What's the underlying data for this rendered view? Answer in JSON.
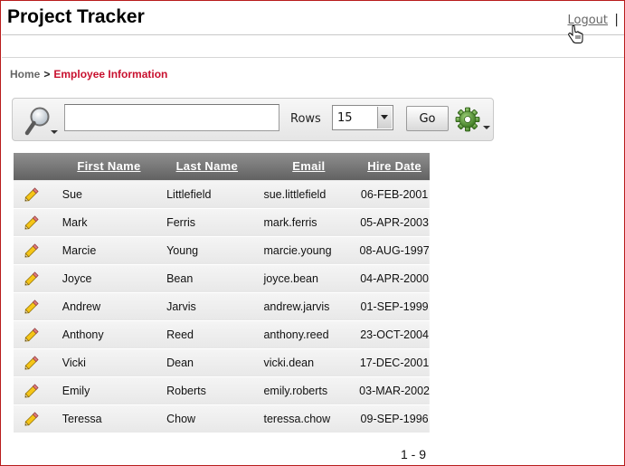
{
  "app": {
    "title": "Project Tracker",
    "logout_label": "Logout",
    "separator": "|"
  },
  "breadcrumb": {
    "home": "Home",
    "separator": ">",
    "current": "Employee Information"
  },
  "search": {
    "value": "",
    "rows_label": "Rows",
    "rows_value": "15",
    "go_label": "Go",
    "icons": [
      "search-icon",
      "gear-icon"
    ]
  },
  "report": {
    "columns": [
      "First Name",
      "Last Name",
      "Email",
      "Hire Date"
    ],
    "rows": [
      {
        "first": "Sue",
        "last": "Littlefield",
        "email": "sue.littlefield",
        "hire": "06-FEB-2001"
      },
      {
        "first": "Mark",
        "last": "Ferris",
        "email": "mark.ferris",
        "hire": "05-APR-2003"
      },
      {
        "first": "Marcie",
        "last": "Young",
        "email": "marcie.young",
        "hire": "08-AUG-1997"
      },
      {
        "first": "Joyce",
        "last": "Bean",
        "email": "joyce.bean",
        "hire": "04-APR-2000"
      },
      {
        "first": "Andrew",
        "last": "Jarvis",
        "email": "andrew.jarvis",
        "hire": "01-SEP-1999"
      },
      {
        "first": "Anthony",
        "last": "Reed",
        "email": "anthony.reed",
        "hire": "23-OCT-2004"
      },
      {
        "first": "Vicki",
        "last": "Dean",
        "email": "vicki.dean",
        "hire": "17-DEC-2001"
      },
      {
        "first": "Emily",
        "last": "Roberts",
        "email": "emily.roberts",
        "hire": "03-MAR-2002"
      },
      {
        "first": "Teressa",
        "last": "Chow",
        "email": "teressa.chow",
        "hire": "09-SEP-1996"
      }
    ],
    "pagination": "1 - 9"
  },
  "colors": {
    "accent": "#c8102e",
    "header_gradient_top": "#8f8f8f",
    "header_gradient_bottom": "#626262",
    "frame_border": "#b81c1c"
  }
}
